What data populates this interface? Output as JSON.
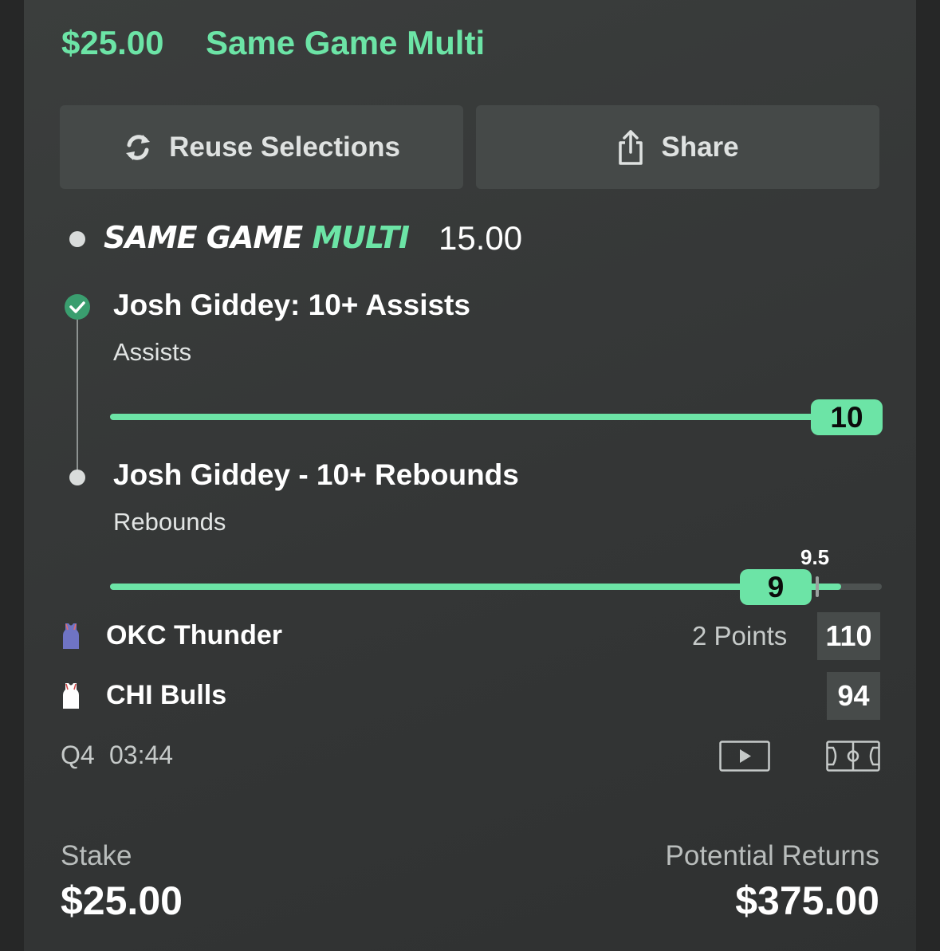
{
  "header": {
    "amount": "$25.00",
    "title": "Same Game Multi"
  },
  "actions": {
    "reuse_label": "Reuse Selections",
    "share_label": "Share"
  },
  "bet": {
    "type_prefix": "SAME GAME ",
    "type_highlight": "MULTI",
    "odds": "15.00",
    "legs": [
      {
        "title": "Josh Giddey: 10+ Assists",
        "market": "Assists",
        "current": "10",
        "status": "won",
        "progress": 1.0
      },
      {
        "title": "Josh Giddey - 10+ Rebounds",
        "market": "Rebounds",
        "current": "9",
        "target": "9.5",
        "status": "pending",
        "progress": 0.947
      }
    ]
  },
  "game": {
    "teams": [
      {
        "name": "OKC Thunder",
        "score": "110",
        "margin": "2 Points",
        "jersey_color": "#6f74c4"
      },
      {
        "name": "CHI Bulls",
        "score": "94",
        "jersey_color": "#ffffff"
      }
    ],
    "period": "Q4",
    "clock": "03:44",
    "icons": [
      "video-icon",
      "court-icon"
    ]
  },
  "footer": {
    "stake_label": "Stake",
    "stake_value": "$25.00",
    "returns_label": "Potential Returns",
    "returns_value": "$375.00"
  },
  "colors": {
    "accent": "#6ce4a6",
    "success": "#3a9e6f",
    "card": "#3b3e3d"
  }
}
